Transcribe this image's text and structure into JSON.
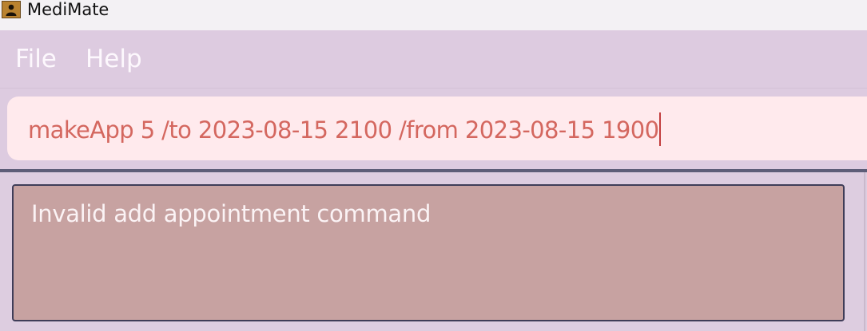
{
  "window": {
    "title": "MediMate",
    "icon": "contact-book-icon"
  },
  "menu": {
    "items": [
      {
        "label": "File"
      },
      {
        "label": "Help"
      }
    ]
  },
  "command": {
    "value": "makeApp 5 /to 2023-08-15 2100 /from 2023-08-15 1900"
  },
  "result": {
    "message": "Invalid add appointment command"
  },
  "colors": {
    "background": "#ddcbe0",
    "command_box": "#ffeaed",
    "command_text": "#d4675f",
    "result_box": "#c7a2a1",
    "result_text": "#fbf3f5",
    "divider": "#5d5d78"
  }
}
